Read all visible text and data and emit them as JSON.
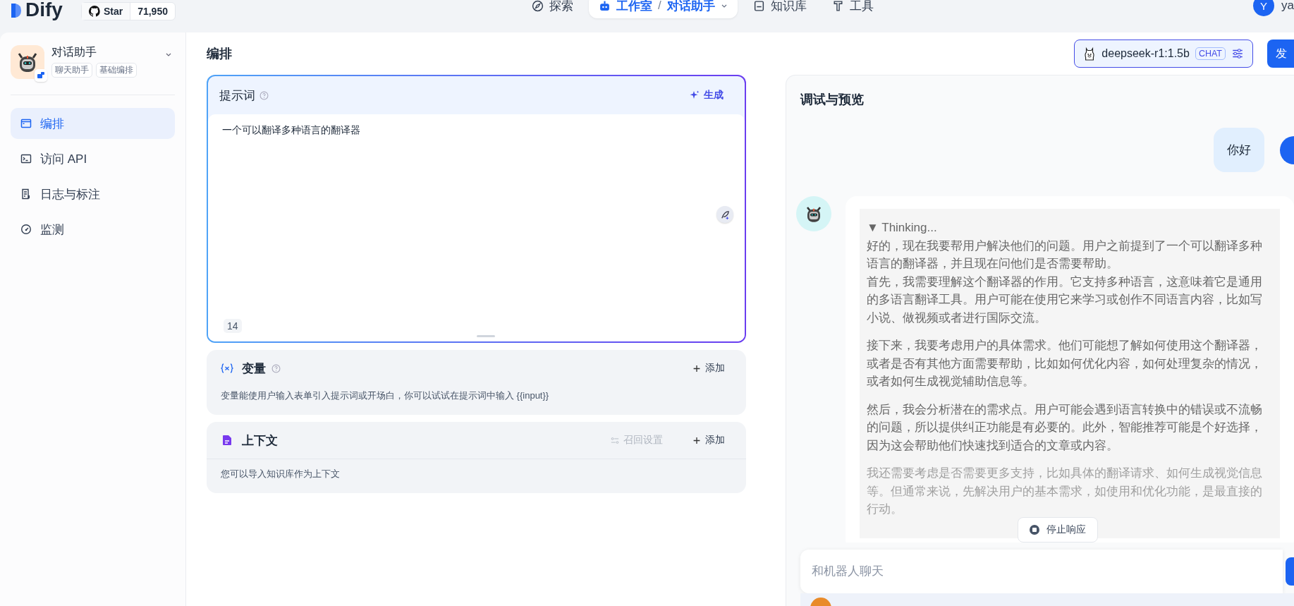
{
  "topbar": {
    "logo": "Dify",
    "github": {
      "label": "Star",
      "count": "71,950"
    },
    "nav": [
      {
        "label": "探索",
        "kind": "explore",
        "selected": false
      },
      {
        "label": "工作室",
        "kind": "studio",
        "selected": true,
        "crumb": "对话助手",
        "separator": "/"
      },
      {
        "label": "知识库",
        "kind": "knowledge",
        "selected": false
      },
      {
        "label": "工具",
        "kind": "tools",
        "selected": false
      }
    ],
    "user": {
      "initial": "Y",
      "name": "ya"
    }
  },
  "sidebar": {
    "app": {
      "name": "对话助手",
      "tags": [
        "聊天助手",
        "基础编排"
      ]
    },
    "items": [
      {
        "label": "编排",
        "kind": "layout",
        "selected": true
      },
      {
        "label": "访问 API",
        "kind": "terminal",
        "selected": false
      },
      {
        "label": "日志与标注",
        "kind": "log",
        "selected": false
      },
      {
        "label": "监测",
        "kind": "gauge",
        "selected": false
      }
    ]
  },
  "editor": {
    "title": "编排",
    "prompt": {
      "title": "提示词",
      "generate": "生成",
      "value": "一个可以翻译多种语言的翻译器",
      "count": "14"
    },
    "variables": {
      "title": "变量",
      "add": "添加",
      "description": "变量能使用户输入表单引入提示词或开场白，你可以试试在提示词中输入 {{input}}"
    },
    "context": {
      "title": "上下文",
      "settings": {
        "label": "召回设置",
        "disabled": true
      },
      "add": "添加",
      "description": "您可以导入知识库作为上下文"
    }
  },
  "model": {
    "name": "deepseek-r1:1.5b",
    "mode": "CHAT"
  },
  "publish": "发",
  "preview": {
    "title": "调试与预览",
    "user_message": "你好",
    "thinking": {
      "label": "▼ Thinking...",
      "paragraphs": [
        [
          "好的，现在我要帮用户解决他们的问题。用户之前提到了一个可以翻译多种语言的翻译器，并且现在问他们是否需要帮助。",
          "首先，我需要理解这个翻译器的作用。它支持多种语言，这意味着它是通用的多语言翻译工具。用户可能在使用它来学习或创作不同语言内容，比如写小说、做视频或者进行国际交流。"
        ],
        [
          "接下来，我要考虑用户的具体需求。他们可能想了解如何使用这个翻译器，或者是否有其他方面需要帮助，比如如何优化内容，如何处理复杂的情况，或者如何生成视觉辅助信息等。"
        ],
        [
          "然后，我会分析潜在的需求点。用户可能会遇到语言转换中的错误或不流畅的问题，所以提供纠正功能是有必要的。此外，智能推荐可能是个好选择，因为这会帮助他们快速找到适合的文章或内容。"
        ],
        [
          "我还需要考虑是否需要更多支持，比如具体的翻译请求、如何生成视觉信息等。但通常来说，先解决用户的基本需求，如使用和优化功能，是最直接的行动。"
        ]
      ]
    },
    "stop": "停止响应",
    "input": {
      "placeholder": "和机器人聊天"
    }
  }
}
